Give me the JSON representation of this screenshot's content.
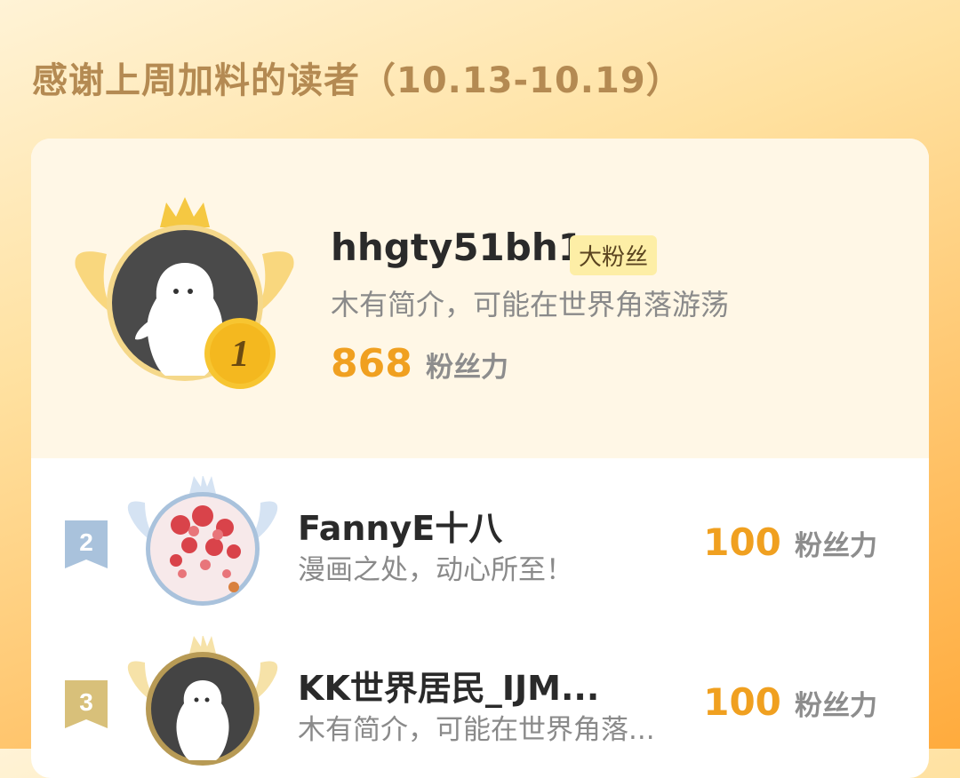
{
  "header": {
    "title": "感谢上周加料的读者（10.13-10.19）"
  },
  "rank1": {
    "rank": "1",
    "name": "hhgty51bh1",
    "badge": "大粉丝",
    "bio": "木有简介，可能在世界角落游荡",
    "score": "868",
    "score_unit": "粉丝力"
  },
  "others": [
    {
      "rank": "2",
      "name": "FannyE十八",
      "bio": "漫画之处，动心所至！",
      "score": "100",
      "score_unit": "粉丝力"
    },
    {
      "rank": "3",
      "name": "KK世界居民_IJM...",
      "bio": "木有简介，可能在世界角落...",
      "score": "100",
      "score_unit": "粉丝力"
    }
  ],
  "colors": {
    "accent": "#f0a020",
    "title": "#b48a52",
    "silver_badge": "#a9c2dc",
    "bronze_badge": "#d8c07a"
  },
  "icons": {
    "crown": "crown-icon",
    "wings": "wings-icon",
    "rank_medal": "rank-medal-icon"
  }
}
